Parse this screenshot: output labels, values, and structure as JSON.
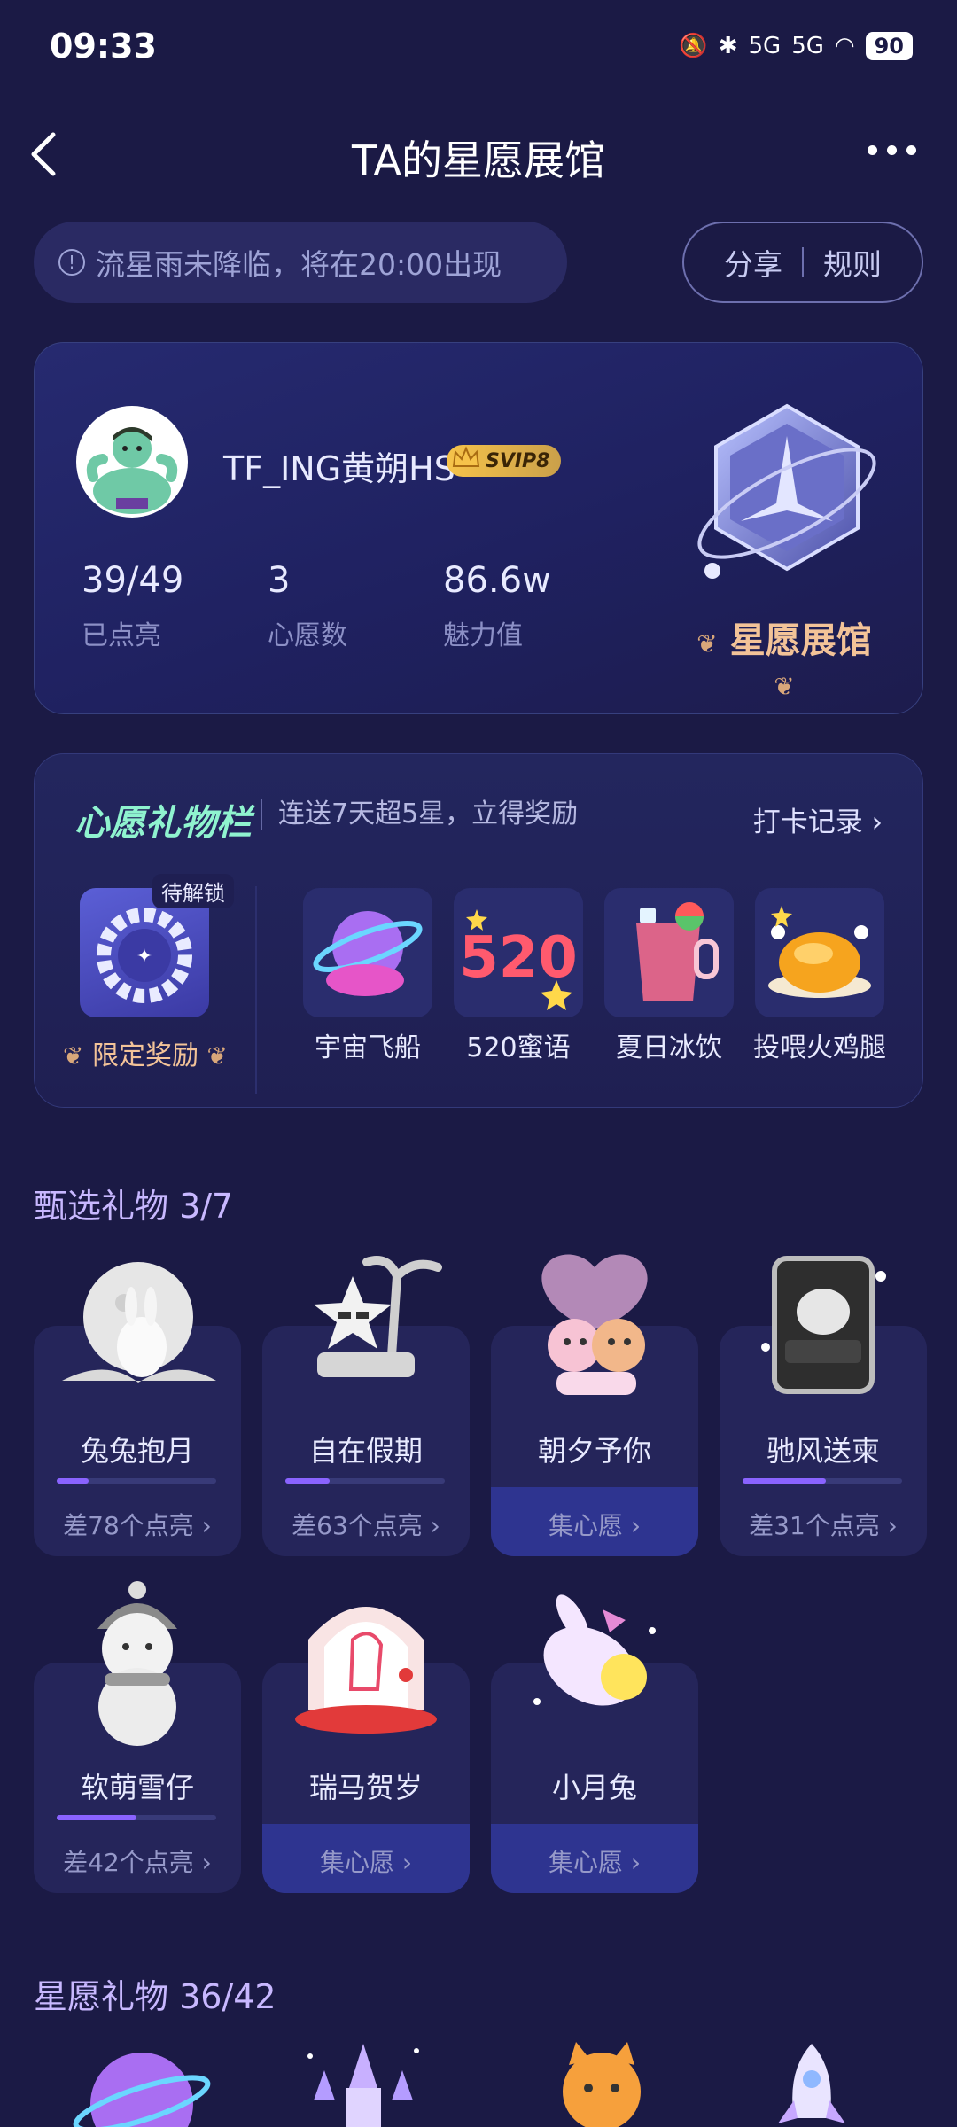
{
  "status": {
    "time": "09:33",
    "signal": "5G",
    "signal2": "5G",
    "battery": "90"
  },
  "header": {
    "title": "TA的星愿展馆"
  },
  "notice": {
    "text": "流星雨未降临，将在20:00出现"
  },
  "actions": {
    "share": "分享",
    "rules": "规则"
  },
  "profile": {
    "username": "TF_ING黄朔HS",
    "badge": "SVIP8",
    "stats": [
      {
        "value": "39/49",
        "label": "已点亮"
      },
      {
        "value": "3",
        "label": "心愿数"
      },
      {
        "value": "86.6w",
        "label": "魅力值"
      }
    ],
    "hall_label": "星愿展馆"
  },
  "wish_bar": {
    "title": "心愿礼物栏",
    "subtitle": "连送7天超5星，立得奖励",
    "link": "打卡记录",
    "locked_tag": "待解锁",
    "reward_label": "限定奖励",
    "gifts": [
      "宇宙飞船",
      "520蜜语",
      "夏日冰饮",
      "投喂火鸡腿"
    ]
  },
  "featured": {
    "title": "甄选礼物 3/7",
    "items": [
      {
        "name": "兔兔抱月",
        "footer": "差78个点亮",
        "progress": 0.2
      },
      {
        "name": "自在假期",
        "footer": "差63个点亮",
        "progress": 0.28
      },
      {
        "name": "朝夕予你",
        "footer": "集心愿"
      },
      {
        "name": "驰风送柬",
        "footer": "差31个点亮",
        "progress": 0.52
      },
      {
        "name": "软萌雪仔",
        "footer": "差42个点亮",
        "progress": 0.5
      },
      {
        "name": "瑞马贺岁",
        "footer": "集心愿"
      },
      {
        "name": "小月兔",
        "footer": "集心愿"
      }
    ]
  },
  "star_gifts": {
    "title": "星愿礼物 36/42"
  }
}
